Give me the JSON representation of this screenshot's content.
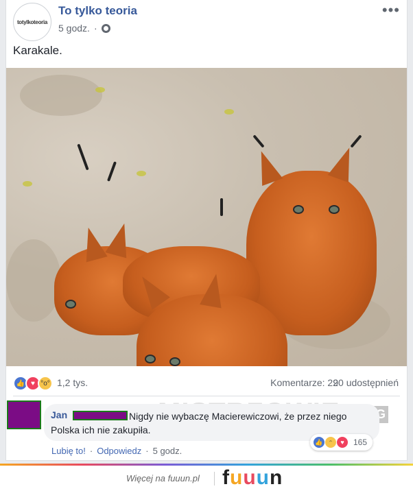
{
  "post": {
    "page_name": "To tylko teoria",
    "avatar_text": "totylkoteoria",
    "time": "5 godz.",
    "separator": "·",
    "more": "•••",
    "caption": "Karakale."
  },
  "stats": {
    "reactions_count": "1,2 tys.",
    "comments": "Komentarze: 29",
    "shares": "20 udostępnień"
  },
  "comment": {
    "author": "Jan",
    "text": "Nigdy nie wybaczę Macierewiczowi, że przez niego Polska ich nie zakupiła.",
    "reaction_count": "165",
    "like_label": "Lubię to!",
    "reply_label": "Odpowiedz",
    "time": "5 godz.",
    "sep": "·"
  },
  "watermark": {
    "text": "MISTRZOWIE",
    "suffix": ".ORG"
  },
  "footer": {
    "text": "Więcej na fuuun.pl",
    "logo": [
      "f",
      "u",
      "u",
      "u",
      "n"
    ],
    "logo_colors": [
      "#222222",
      "#f5a623",
      "#e84a5f",
      "#33a3dc",
      "#222222"
    ]
  },
  "colors": {
    "link": "#365899",
    "like": "#4a76d0",
    "love": "#f0405e",
    "wow": "#f7c44b"
  }
}
